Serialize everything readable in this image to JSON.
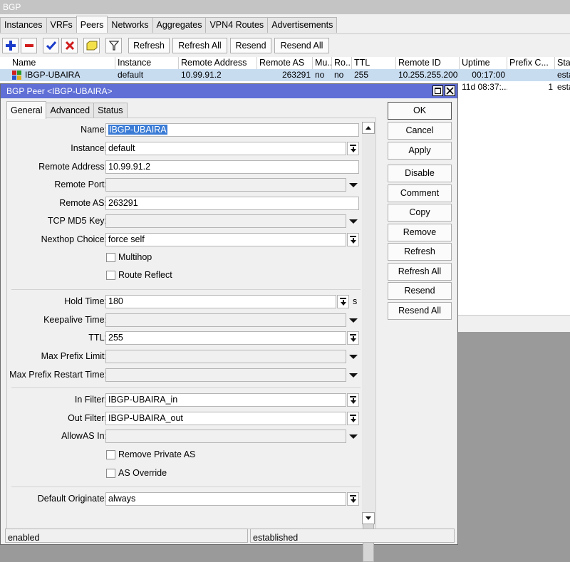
{
  "window": {
    "title": "BGP"
  },
  "main_tabs": [
    "Instances",
    "VRFs",
    "Peers",
    "Networks",
    "Aggregates",
    "VPN4 Routes",
    "Advertisements"
  ],
  "toolbar": {
    "refresh": "Refresh",
    "refresh_all": "Refresh All",
    "resend": "Resend",
    "resend_all": "Resend All"
  },
  "peers_table": {
    "columns": [
      "Name",
      "Instance",
      "Remote Address",
      "Remote AS",
      "Mu...",
      "Ro...",
      "TTL",
      "Remote ID",
      "Uptime",
      "Prefix C...",
      "Stat"
    ],
    "rows": [
      {
        "name": "IBGP-UBAIRA",
        "instance": "default",
        "remote_address": "10.99.91.2",
        "remote_as": "263291",
        "multihop": "no",
        "route_reflect": "no",
        "ttl": "255",
        "remote_id": "10.255.255.200",
        "uptime": "00:17:00",
        "prefix_count": "",
        "state": "esta"
      },
      {
        "uptime": "11d 08:37:...",
        "prefix_count": "1",
        "state": "esta"
      }
    ]
  },
  "dialog": {
    "title": "BGP Peer <IBGP-UBAIRA>",
    "tabs": [
      "General",
      "Advanced",
      "Status"
    ],
    "fields": {
      "name": {
        "label": "Name:",
        "value": "IBGP-UBAIRA"
      },
      "instance": {
        "label": "Instance:",
        "value": "default"
      },
      "remote_address": {
        "label": "Remote Address:",
        "value": "10.99.91.2"
      },
      "remote_port": {
        "label": "Remote Port:",
        "value": ""
      },
      "remote_as": {
        "label": "Remote AS:",
        "value": "263291"
      },
      "tcp_md5_key": {
        "label": "TCP MD5 Key:",
        "value": ""
      },
      "nexthop_choice": {
        "label": "Nexthop Choice:",
        "value": "force self"
      },
      "multihop": {
        "label": "Multihop"
      },
      "route_reflect": {
        "label": "Route Reflect"
      },
      "hold_time": {
        "label": "Hold Time:",
        "value": "180",
        "unit": "s"
      },
      "keepalive_time": {
        "label": "Keepalive Time:",
        "value": ""
      },
      "ttl": {
        "label": "TTL:",
        "value": "255"
      },
      "max_prefix_limit": {
        "label": "Max Prefix Limit:",
        "value": ""
      },
      "max_prefix_restart_time": {
        "label": "Max Prefix Restart Time:",
        "value": ""
      },
      "in_filter": {
        "label": "In Filter:",
        "value": "IBGP-UBAIRA_in"
      },
      "out_filter": {
        "label": "Out Filter:",
        "value": "IBGP-UBAIRA_out"
      },
      "allowas_in": {
        "label": "AllowAS In:",
        "value": ""
      },
      "remove_private_as": {
        "label": "Remove Private AS"
      },
      "as_override": {
        "label": "AS Override"
      },
      "default_originate": {
        "label": "Default Originate:",
        "value": "always"
      }
    },
    "buttons": [
      "OK",
      "Cancel",
      "Apply",
      "Disable",
      "Comment",
      "Copy",
      "Remove",
      "Refresh",
      "Refresh All",
      "Resend",
      "Resend All"
    ],
    "status": {
      "left": "enabled",
      "right": "established"
    }
  },
  "colors": {
    "dialog_titlebar": "#5f6fd6",
    "selected_row": "#c8dcf0",
    "add_icon": "#1a3cc9",
    "remove_icon": "#d01c1c"
  }
}
